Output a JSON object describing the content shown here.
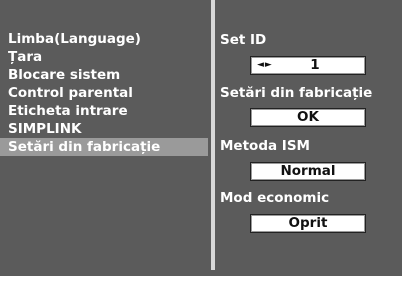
{
  "menu": {
    "items": [
      {
        "label": "Limba(Language)",
        "selected": false
      },
      {
        "label": "Țara",
        "selected": false
      },
      {
        "label": "Blocare sistem",
        "selected": false
      },
      {
        "label": "Control parental",
        "selected": false
      },
      {
        "label": "Eticheta intrare",
        "selected": false
      },
      {
        "label": "SIMPLINK",
        "selected": false
      },
      {
        "label": "Setări din fabricație",
        "selected": true
      }
    ]
  },
  "settings": {
    "set_id": {
      "label": "Set ID",
      "value": "1",
      "arrows": "◄►",
      "icon": "left-right-arrows-icon"
    },
    "factory_reset": {
      "label": "Setări din fabricație",
      "button_label": "OK"
    },
    "ism_method": {
      "label": "Metoda ISM",
      "value": "Normal"
    },
    "economy_mode": {
      "label": "Mod economic",
      "value": "Oprit"
    }
  },
  "colors": {
    "panel_background": "#5b5b5b",
    "selected_item": "#9a9a9a",
    "divider": "#d8d8d8",
    "text": "#ffffff",
    "value_box": "#ffffff"
  }
}
